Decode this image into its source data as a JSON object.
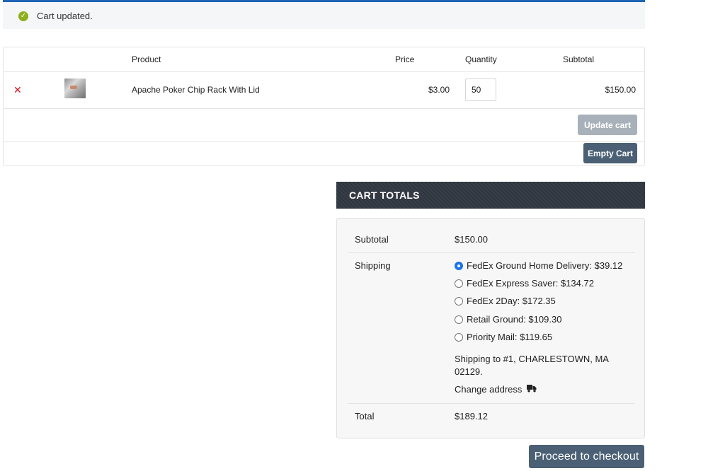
{
  "notice": {
    "message": "Cart updated.",
    "icon": "check-circle-icon",
    "color": "#8fae1b",
    "border_color": "#1e63b5"
  },
  "cart": {
    "headers": {
      "product": "Product",
      "price": "Price",
      "quantity": "Quantity",
      "subtotal": "Subtotal"
    },
    "items": [
      {
        "remove_icon": "close-icon",
        "name": "Apache Poker Chip Rack With Lid",
        "price": "$3.00",
        "quantity": "50",
        "subtotal": "$150.00"
      }
    ],
    "update_label": "Update cart",
    "empty_label": "Empty Cart"
  },
  "totals": {
    "title": "CART TOTALS",
    "subtotal_label": "Subtotal",
    "subtotal_value": "$150.00",
    "shipping_label": "Shipping",
    "shipping_options": [
      {
        "label": "FedEx Ground Home Delivery: $39.12",
        "selected": true
      },
      {
        "label": "FedEx Express Saver: $134.72",
        "selected": false
      },
      {
        "label": "FedEx 2Day: $172.35",
        "selected": false
      },
      {
        "label": "Retail Ground: $109.30",
        "selected": false
      },
      {
        "label": "Priority Mail: $119.65",
        "selected": false
      }
    ],
    "shipping_to": "Shipping to #1, CHARLESTOWN, MA 02129.",
    "change_address": "Change address",
    "change_address_icon": "truck-icon",
    "total_label": "Total",
    "total_value": "$189.12"
  },
  "checkout_label": "Proceed to checkout",
  "colors": {
    "button_dark": "#4b6075",
    "button_disabled": "#a8b1b9",
    "remove": "#d0121b",
    "radio_selected": "#1a73e8",
    "header_bg": "#323841"
  }
}
